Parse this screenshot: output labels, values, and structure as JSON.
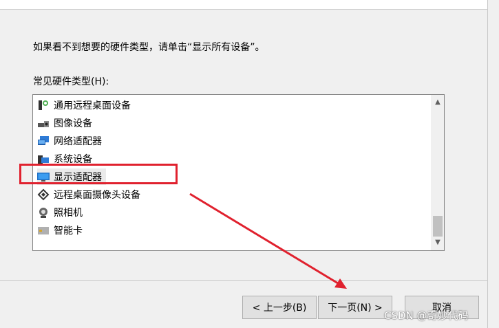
{
  "instruction_text": "如果看不到想要的硬件类型，请单击“显示所有设备”。",
  "list": {
    "label": "常见硬件类型(H):",
    "items": [
      {
        "label": "通用远程桌面设备",
        "icon": "remote-desktop-icon"
      },
      {
        "label": "图像设备",
        "icon": "camera-scanner-icon"
      },
      {
        "label": "网络适配器",
        "icon": "network-adapter-icon"
      },
      {
        "label": "系统设备",
        "icon": "system-device-icon"
      },
      {
        "label": "显示适配器",
        "icon": "display-adapter-icon",
        "selected": true
      },
      {
        "label": "远程桌面摄像头设备",
        "icon": "remote-camera-icon"
      },
      {
        "label": "照相机",
        "icon": "webcam-icon"
      },
      {
        "label": "智能卡",
        "icon": "smart-card-icon"
      }
    ]
  },
  "buttons": {
    "back": "< 上一步(B)",
    "next": "下一页(N) >",
    "cancel": "取消"
  },
  "watermark": "CSDN @奇妙代码",
  "colors": {
    "annotation_red": "#e0212e",
    "background": "#f0f0f0"
  }
}
